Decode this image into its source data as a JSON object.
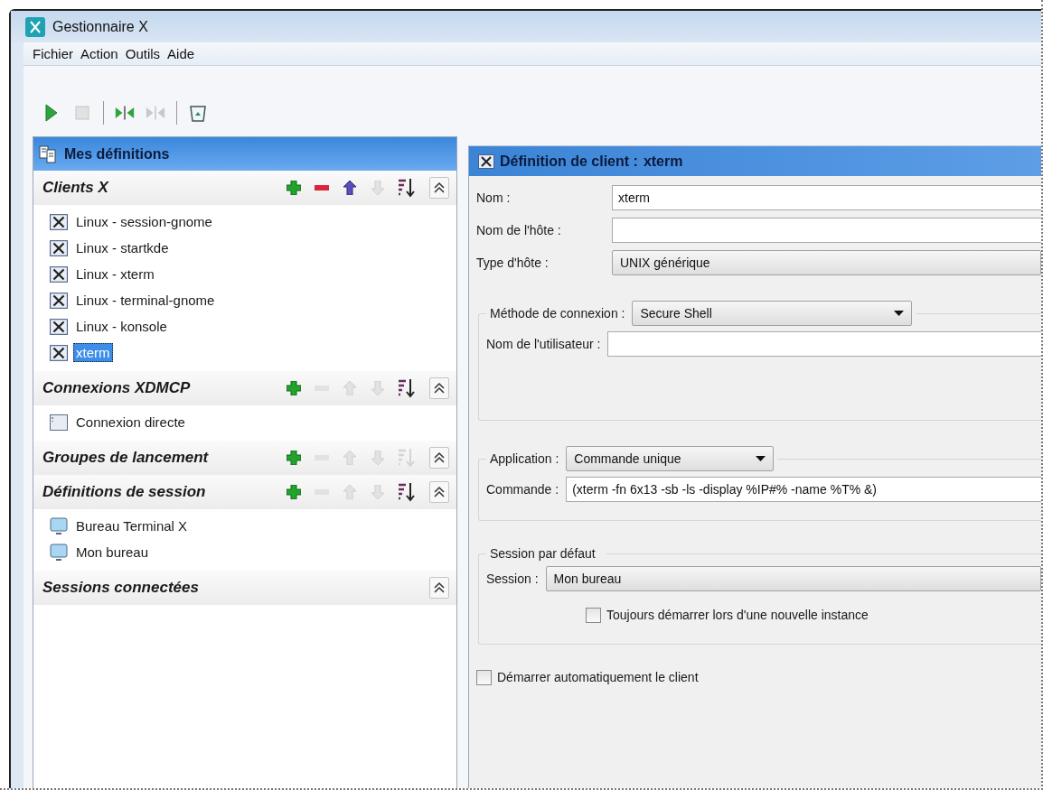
{
  "window": {
    "title": "Gestionnaire X"
  },
  "menu": [
    {
      "label": "Fichier"
    },
    {
      "label": "Action"
    },
    {
      "label": "Outils"
    },
    {
      "label": "Aide"
    }
  ],
  "toolbar": [
    {
      "kind": "play",
      "disabled": false
    },
    {
      "kind": "stop",
      "disabled": true
    },
    {
      "kind": "separator"
    },
    {
      "kind": "connect",
      "disabled": false
    },
    {
      "kind": "disconnect",
      "disabled": true
    },
    {
      "kind": "separator"
    },
    {
      "kind": "trash",
      "disabled": false
    }
  ],
  "left_panel": {
    "title": "Mes définitions",
    "sections": [
      {
        "title": "Clients X",
        "tools": [
          {
            "kind": "add",
            "disabled": false
          },
          {
            "kind": "remove",
            "disabled": false
          },
          {
            "kind": "up",
            "disabled": false
          },
          {
            "kind": "down",
            "disabled": true
          },
          {
            "kind": "sort",
            "disabled": false
          },
          {
            "kind": "collapse",
            "disabled": false
          }
        ],
        "items": [
          {
            "label": "Linux - session-gnome",
            "kind": "client",
            "selected": false
          },
          {
            "label": "Linux - startkde",
            "kind": "client",
            "selected": false
          },
          {
            "label": "Linux - xterm",
            "kind": "client",
            "selected": false
          },
          {
            "label": "Linux - terminal-gnome",
            "kind": "client",
            "selected": false
          },
          {
            "label": "Linux - konsole",
            "kind": "client",
            "selected": false
          },
          {
            "label": "xterm",
            "kind": "client",
            "selected": true
          }
        ]
      },
      {
        "title": "Connexions XDMCP",
        "tools": [
          {
            "kind": "add",
            "disabled": false
          },
          {
            "kind": "remove",
            "disabled": true
          },
          {
            "kind": "up",
            "disabled": true
          },
          {
            "kind": "down",
            "disabled": true
          },
          {
            "kind": "sort",
            "disabled": false
          },
          {
            "kind": "collapse",
            "disabled": false
          }
        ],
        "items": [
          {
            "label": "Connexion directe",
            "kind": "window",
            "selected": false
          }
        ]
      },
      {
        "title": "Groupes de lancement",
        "tools": [
          {
            "kind": "add",
            "disabled": false
          },
          {
            "kind": "remove",
            "disabled": true
          },
          {
            "kind": "up",
            "disabled": true
          },
          {
            "kind": "down",
            "disabled": true
          },
          {
            "kind": "sort",
            "disabled": true
          },
          {
            "kind": "collapse",
            "disabled": false
          }
        ]
      },
      {
        "title": "Définitions de session",
        "tools": [
          {
            "kind": "add",
            "disabled": false
          },
          {
            "kind": "remove",
            "disabled": true
          },
          {
            "kind": "up",
            "disabled": true
          },
          {
            "kind": "down",
            "disabled": true
          },
          {
            "kind": "sort",
            "disabled": false
          },
          {
            "kind": "collapse",
            "disabled": false
          }
        ],
        "items": [
          {
            "label": "Bureau Terminal X",
            "kind": "monitor",
            "selected": false
          },
          {
            "label": "Mon bureau",
            "kind": "monitor",
            "selected": false
          }
        ]
      },
      {
        "title": "Sessions connectées",
        "tools": [
          {
            "kind": "collapse",
            "disabled": false
          }
        ]
      }
    ]
  },
  "right_panel": {
    "title": "Définition de client :",
    "subject": "xterm",
    "fields": [
      {
        "kind": "text",
        "label": "Nom :",
        "value": "xterm"
      },
      {
        "kind": "text",
        "label": "Nom de l'hôte :"
      },
      {
        "kind": "select",
        "label": "Type d'hôte :",
        "value": "UNIX générique"
      }
    ],
    "groups": [
      {
        "legend": {
          "kind": "select",
          "label": "Méthode de connexion :",
          "value": "Secure Shell"
        },
        "rows": [
          {
            "kind": "text",
            "label": "Nom de l'utilisateur :"
          }
        ]
      },
      {
        "legend": {
          "kind": "select",
          "label": "Application :",
          "value": "Commande unique"
        },
        "rows": [
          {
            "kind": "text",
            "label": "Commande :",
            "value": "(xterm -fn 6x13 -sb -ls -display %IP#% -name %T% &)"
          }
        ]
      },
      {
        "legend": {
          "kind": "caption",
          "label": "Session par défaut"
        },
        "rows": [
          {
            "kind": "select",
            "label": "Session :",
            "value": "Mon bureau"
          },
          {
            "kind": "checkbox",
            "label": "Toujours démarrer lors d'une nouvelle instance",
            "checked": false
          }
        ]
      }
    ],
    "options": [
      {
        "kind": "checkbox",
        "label": "Démarrer automatiquement le client",
        "checked": false
      }
    ]
  }
}
